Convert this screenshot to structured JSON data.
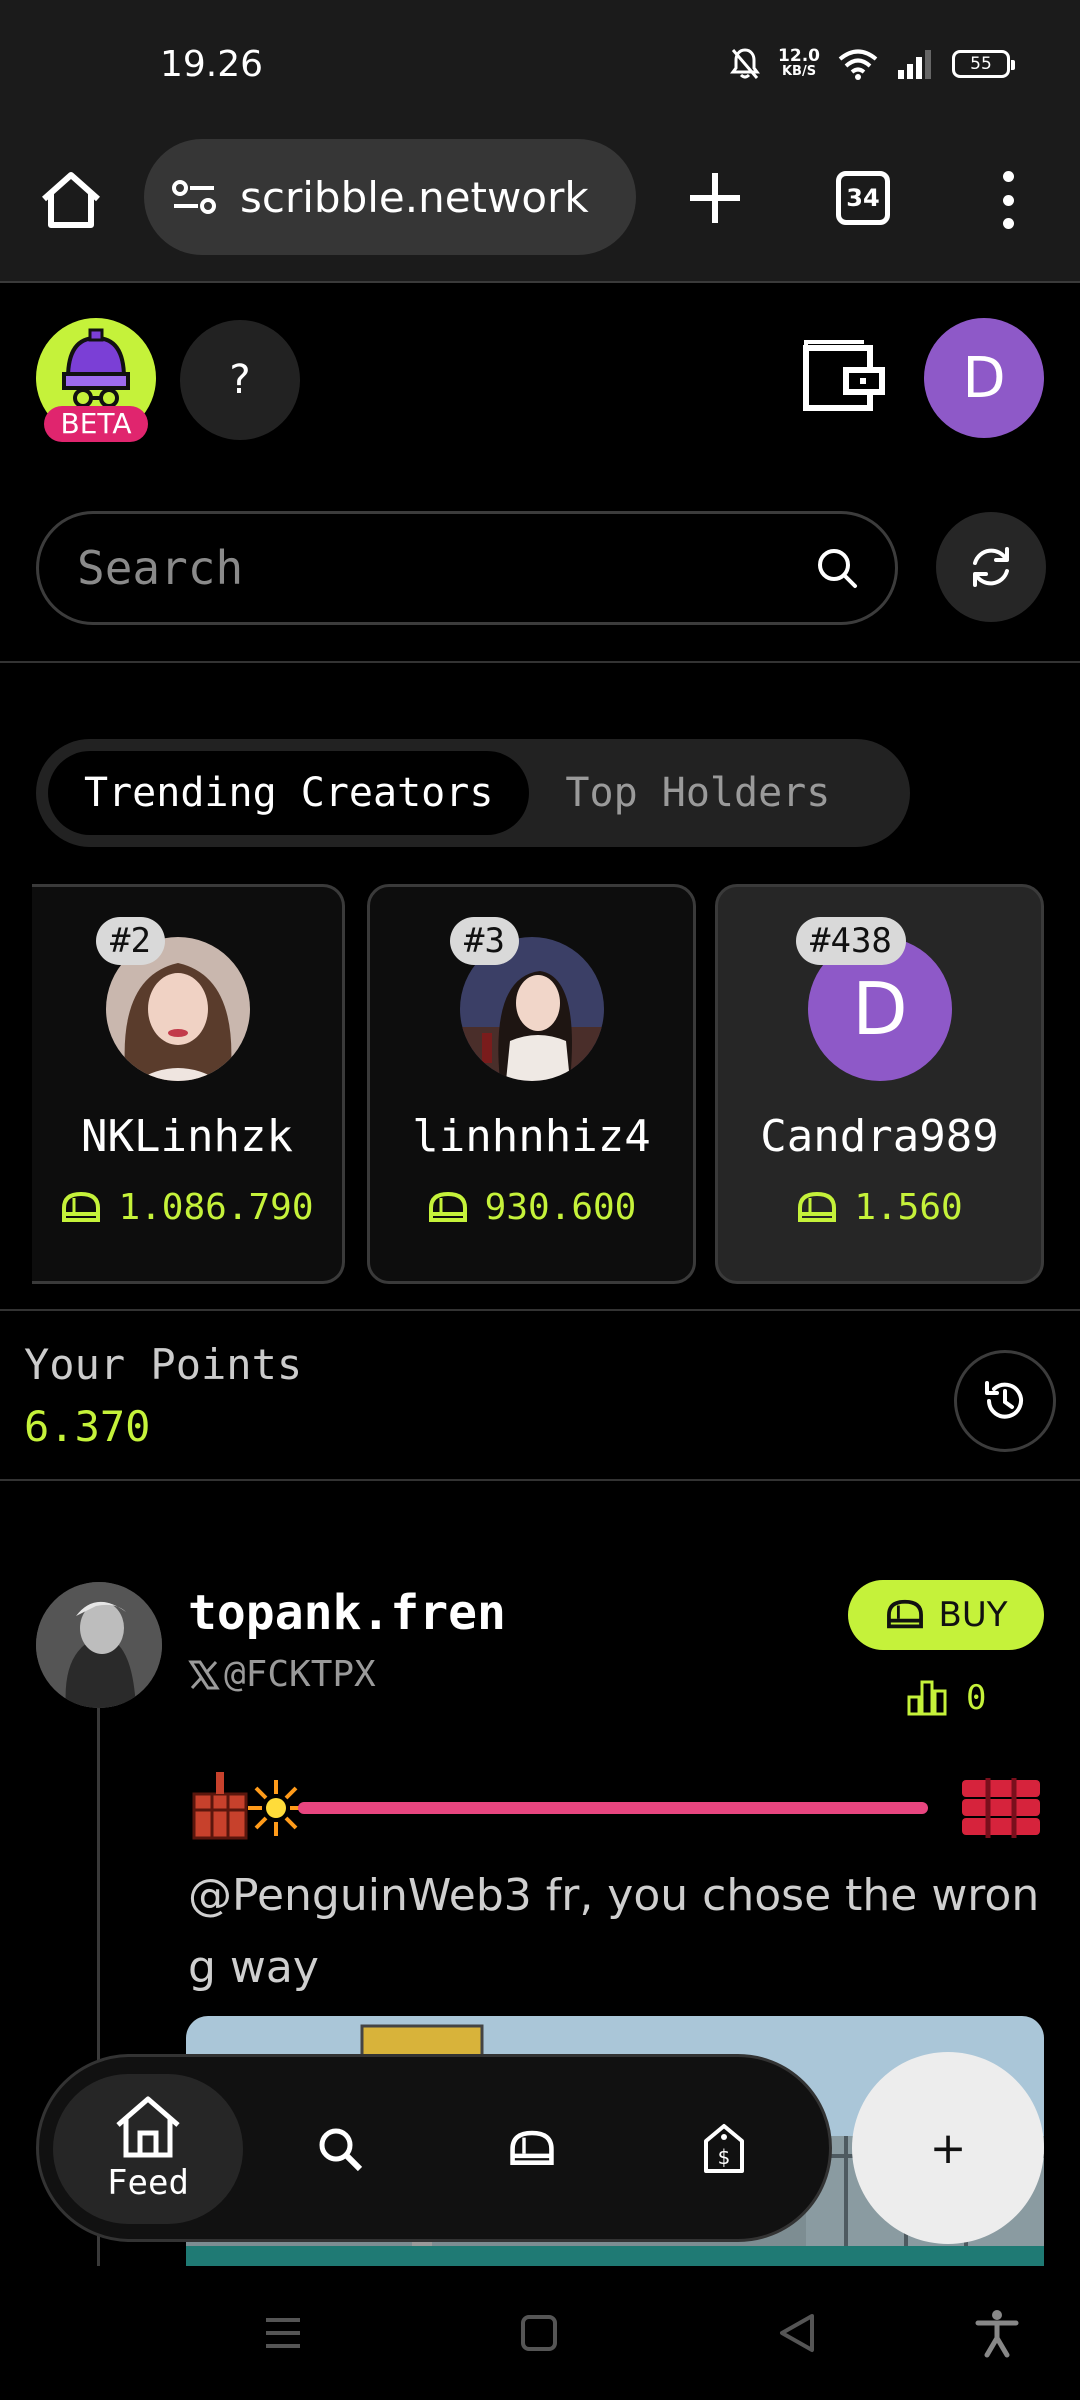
{
  "status_bar": {
    "time": "19.26",
    "net_speed_value": "12.0",
    "net_speed_unit": "KB/S",
    "battery": "55"
  },
  "browser": {
    "url": "scribble.network",
    "tab_count": "34"
  },
  "header": {
    "beta_label": "BETA",
    "help_label": "?",
    "avatar_initial": "D"
  },
  "search": {
    "placeholder": "Search"
  },
  "tabs": [
    {
      "label": "Trending Creators",
      "active": true
    },
    {
      "label": "Top Holders",
      "active": false
    }
  ],
  "creators": [
    {
      "rank": "#2",
      "name": "NKLinhzk",
      "points": "1.086.790"
    },
    {
      "rank": "#3",
      "name": "linhnhiz4",
      "points": "930.600"
    },
    {
      "rank": "#438",
      "name": "Candra989",
      "points": "1.560",
      "initial": "D"
    }
  ],
  "your_points": {
    "label": "Your Points",
    "value": "6.370"
  },
  "post": {
    "author": "topank.fren",
    "handle": "@FCKTPX",
    "buy_label": "BUY",
    "holders": "0",
    "text": "@PenguinWeb3 fr, you chose the wrong way"
  },
  "bottom_nav": {
    "feed_label": "Feed",
    "fab_label": "+"
  },
  "colors": {
    "accent": "#c5f23a",
    "fuse": "#e8457f",
    "beta": "#e0256e",
    "avatar": "#8e59c8"
  }
}
